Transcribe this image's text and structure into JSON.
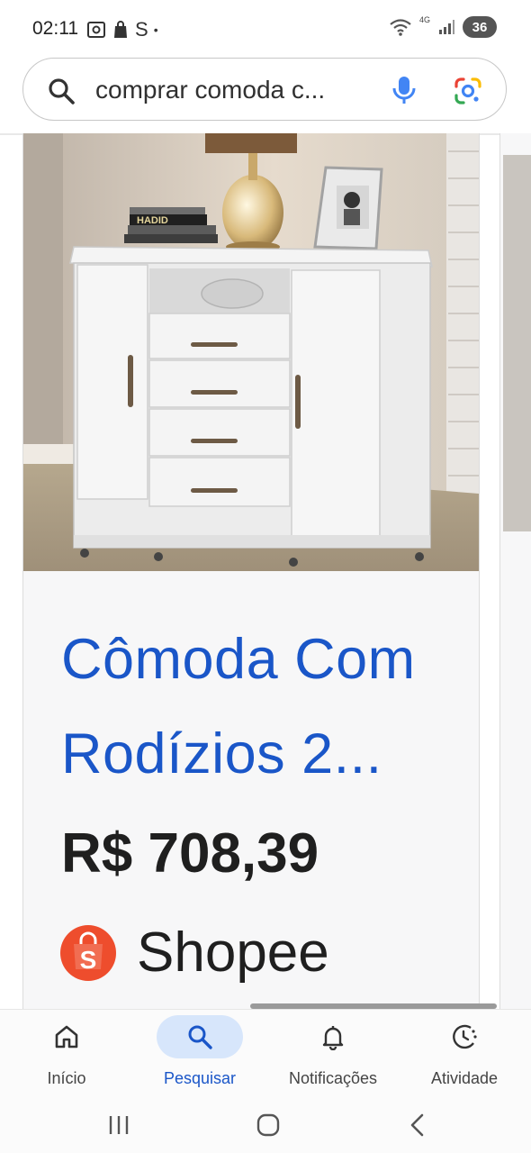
{
  "status_bar": {
    "time": "02:11",
    "left_icons": [
      "screenshot-icon",
      "shopping-bag-icon"
    ],
    "s_label": "S",
    "dot": "•",
    "network_label": "4G",
    "battery_level": "36"
  },
  "search": {
    "query": "comprar comoda c..."
  },
  "result": {
    "title_line1": "Cômoda Com",
    "title_line2": "Rodízios 2...",
    "price": "R$ 708,39",
    "store": "Shopee",
    "logo_letter": "S",
    "book_label": "HADID"
  },
  "bottom_nav": {
    "items": [
      {
        "label": "Início",
        "icon": "home-icon"
      },
      {
        "label": "Pesquisar",
        "icon": "search-icon",
        "active": true
      },
      {
        "label": "Notificações",
        "icon": "bell-icon"
      },
      {
        "label": "Atividade",
        "icon": "activity-icon"
      }
    ]
  },
  "colors": {
    "link_blue": "#1a56c8",
    "active_tab_bg": "#d7e6fb",
    "shopee_orange": "#ee4d2d"
  }
}
